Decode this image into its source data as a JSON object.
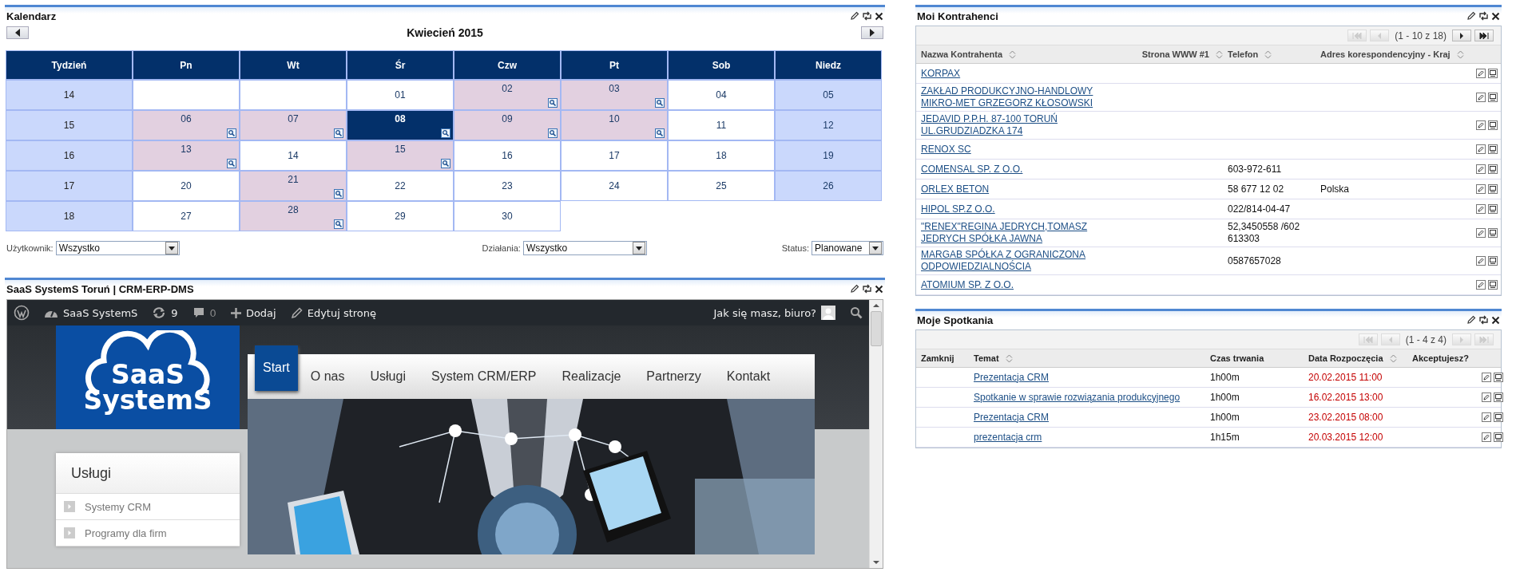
{
  "calendar": {
    "title": "Kalendarz",
    "month": "Kwiecień 2015",
    "columns": [
      {
        "label": "Tydzień",
        "shaded": true
      },
      {
        "label": "Pn",
        "shaded": false
      },
      {
        "label": "Wt",
        "shaded": false
      },
      {
        "label": "Śr",
        "shaded": false
      },
      {
        "label": "Czw",
        "shaded": false
      },
      {
        "label": "Pt",
        "shaded": false
      },
      {
        "label": "Sob",
        "shaded": false
      },
      {
        "label": "Niedz",
        "shaded": true
      }
    ],
    "weeks": [
      {
        "week": "14",
        "days": [
          {
            "kind": "blank"
          },
          {
            "kind": "blank"
          },
          {
            "kind": "day",
            "day": "01",
            "events": false,
            "selected": false
          },
          {
            "kind": "day",
            "day": "02",
            "events": true,
            "selected": false
          },
          {
            "kind": "day",
            "day": "03",
            "events": true,
            "selected": false
          },
          {
            "kind": "day",
            "day": "04",
            "events": false,
            "selected": false
          },
          {
            "kind": "day",
            "day": "05",
            "events": false,
            "selected": false
          }
        ]
      },
      {
        "week": "15",
        "days": [
          {
            "kind": "day",
            "day": "06",
            "events": true,
            "selected": false
          },
          {
            "kind": "day",
            "day": "07",
            "events": true,
            "selected": false
          },
          {
            "kind": "day",
            "day": "08",
            "events": true,
            "selected": true
          },
          {
            "kind": "day",
            "day": "09",
            "events": true,
            "selected": false
          },
          {
            "kind": "day",
            "day": "10",
            "events": true,
            "selected": false
          },
          {
            "kind": "day",
            "day": "11",
            "events": false,
            "selected": false
          },
          {
            "kind": "day",
            "day": "12",
            "events": false,
            "selected": false
          }
        ]
      },
      {
        "week": "16",
        "days": [
          {
            "kind": "day",
            "day": "13",
            "events": true,
            "selected": false
          },
          {
            "kind": "day",
            "day": "14",
            "events": false,
            "selected": false
          },
          {
            "kind": "day",
            "day": "15",
            "events": true,
            "selected": false
          },
          {
            "kind": "day",
            "day": "16",
            "events": false,
            "selected": false
          },
          {
            "kind": "day",
            "day": "17",
            "events": false,
            "selected": false
          },
          {
            "kind": "day",
            "day": "18",
            "events": false,
            "selected": false
          },
          {
            "kind": "day",
            "day": "19",
            "events": false,
            "selected": false
          }
        ]
      },
      {
        "week": "17",
        "days": [
          {
            "kind": "day",
            "day": "20",
            "events": false,
            "selected": false
          },
          {
            "kind": "day",
            "day": "21",
            "events": true,
            "selected": false
          },
          {
            "kind": "day",
            "day": "22",
            "events": false,
            "selected": false
          },
          {
            "kind": "day",
            "day": "23",
            "events": false,
            "selected": false
          },
          {
            "kind": "day",
            "day": "24",
            "events": false,
            "selected": false
          },
          {
            "kind": "day",
            "day": "25",
            "events": false,
            "selected": false
          },
          {
            "kind": "day",
            "day": "26",
            "events": false,
            "selected": false
          }
        ]
      },
      {
        "week": "18",
        "days": [
          {
            "kind": "day",
            "day": "27",
            "events": false,
            "selected": false
          },
          {
            "kind": "day",
            "day": "28",
            "events": true,
            "selected": false
          },
          {
            "kind": "day",
            "day": "29",
            "events": false,
            "selected": false
          },
          {
            "kind": "day",
            "day": "30",
            "events": false,
            "selected": false
          }
        ]
      }
    ],
    "filters": [
      {
        "label": "Użytkownik:",
        "value": "Wszystko"
      },
      {
        "label": "Działania:",
        "value": "Wszystko"
      },
      {
        "label": "Status:",
        "value": "Planowane"
      }
    ]
  },
  "website": {
    "title": "SaaS SystemS Toruń | CRM-ERP-DMS",
    "admin_bar": {
      "site": "SaaS SystemS",
      "updates": "9",
      "comments": "0",
      "add": "Dodaj",
      "edit": "Edytuj stronę",
      "greeting": "Jak się masz, biuro?"
    },
    "logo": [
      "SaaS",
      "SystemS"
    ],
    "menu": [
      {
        "label": "Start",
        "selected": true
      },
      {
        "label": "O nas",
        "selected": false
      },
      {
        "label": "Usługi",
        "selected": false
      },
      {
        "label": "System CRM/ERP",
        "selected": false
      },
      {
        "label": "Realizacje",
        "selected": false
      },
      {
        "label": "Partnerzy",
        "selected": false
      },
      {
        "label": "Kontakt",
        "selected": false
      }
    ],
    "sidebar": {
      "title": "Usługi",
      "items": [
        "Systemy CRM",
        "Programy dla firm"
      ]
    }
  },
  "contractors": {
    "title": "Moi Kontrahenci",
    "range": "(1 - 10 z 18)",
    "pager": [
      {
        "kind": "first",
        "disabled": true
      },
      {
        "kind": "prev",
        "disabled": true
      },
      {
        "kind": "next",
        "disabled": false
      },
      {
        "kind": "last",
        "disabled": false
      }
    ],
    "columns": [
      {
        "label": "Nazwa Kontrahenta",
        "sortable": true
      },
      {
        "label": "Strona WWW #1",
        "sortable": true
      },
      {
        "label": "Telefon",
        "sortable": true
      },
      {
        "label": "Adres korespondencyjny - Kraj",
        "sortable": true
      }
    ],
    "rows": [
      {
        "name": "KORPAX"
      },
      {
        "name": "ZAKŁAD PRODUKCYJNO-HANDLOWY MIKRO-MET GRZEGORZ KŁOSOWSKI"
      },
      {
        "name": "JEDAVID P.P.H. 87-100 TORUŃ UL.GRUDZIADZKA 174"
      },
      {
        "name": "RENOX SC"
      },
      {
        "name": "COMENSAL SP. Z O.O.",
        "phone": "603-972-611"
      },
      {
        "name": "ORLEX BETON",
        "phone": "58 677 12 02",
        "country": "Polska"
      },
      {
        "name": "HIPOL SP.Z O.O.",
        "phone": "022/814-04-47"
      },
      {
        "name": "\"RENEX\"REGINA JEDRYCH,TOMASZ JEDRYCH SPÓŁKA JAWNA",
        "phone": "52,3450558 /602 613303"
      },
      {
        "name": "MARGAB SPÓŁKA Z OGRANICZONA ODPOWIEDZIALNOŚCIA",
        "phone": "0587657028"
      },
      {
        "name": "ATOMIUM SP. Z O.O."
      }
    ]
  },
  "meetings": {
    "title": "Moje Spotkania",
    "range": "(1 - 4 z 4)",
    "pager": [
      {
        "kind": "first",
        "disabled": true
      },
      {
        "kind": "prev",
        "disabled": true
      },
      {
        "kind": "next",
        "disabled": true
      },
      {
        "kind": "last",
        "disabled": true
      }
    ],
    "columns": [
      {
        "label": "Zamknij",
        "sortable": false
      },
      {
        "label": "Temat",
        "sortable": true
      },
      {
        "label": "Czas trwania",
        "sortable": false
      },
      {
        "label": "Data Rozpoczęcia",
        "sortable": true
      },
      {
        "label": "Akceptujesz?",
        "sortable": false
      }
    ],
    "rows": [
      {
        "topic": "Prezentacja CRM",
        "duration": "1h00m",
        "start": "20.02.2015 11:00"
      },
      {
        "topic": "Spotkanie w sprawie rozwiązania produkcyjnego",
        "duration": "1h00m",
        "start": "16.02.2015 13:00"
      },
      {
        "topic": "Prezentacja CRM",
        "duration": "1h00m",
        "start": "23.02.2015 08:00"
      },
      {
        "topic": "prezentacja crm",
        "duration": "1h15m",
        "start": "20.03.2015 12:00"
      }
    ]
  }
}
